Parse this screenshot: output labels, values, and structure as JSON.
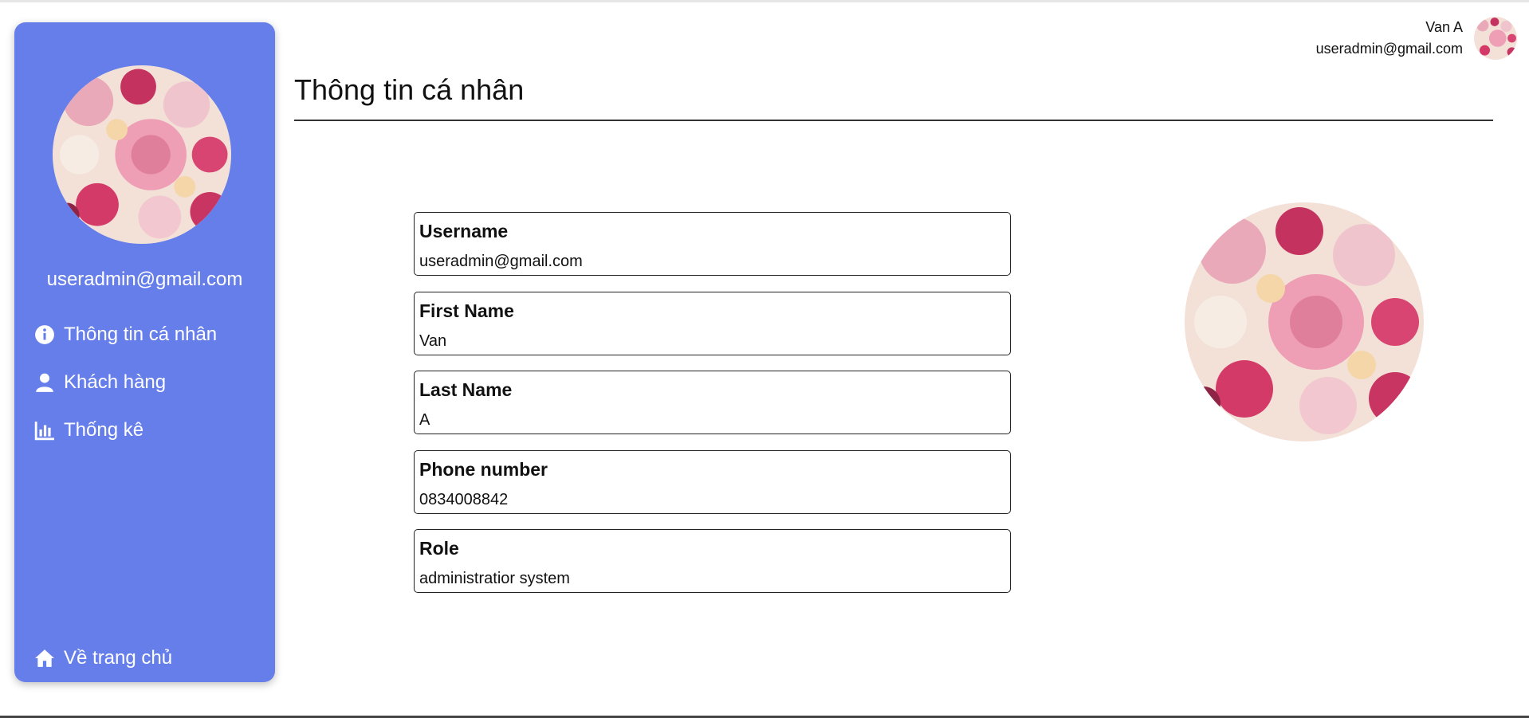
{
  "sidebar": {
    "email": "useradmin@gmail.com",
    "items": [
      {
        "label": "Thông tin cá nhân",
        "icon": "info-circle-icon"
      },
      {
        "label": "Khách hàng",
        "icon": "user-icon"
      },
      {
        "label": "Thống kê",
        "icon": "bar-chart-icon"
      }
    ],
    "home": {
      "label": "Về trang chủ",
      "icon": "home-icon"
    }
  },
  "header": {
    "user_name": "Van A",
    "user_email": "useradmin@gmail.com"
  },
  "page": {
    "title": "Thông tin cá nhân"
  },
  "fields": [
    {
      "label": "Username",
      "value": "useradmin@gmail.com"
    },
    {
      "label": "First Name",
      "value": "Van"
    },
    {
      "label": "Last Name",
      "value": "A"
    },
    {
      "label": "Phone number",
      "value": "0834008842"
    },
    {
      "label": "Role",
      "value": "administratior system"
    }
  ],
  "colors": {
    "sidebar_bg": "#667eea",
    "text": "#111111",
    "border": "#222222"
  }
}
